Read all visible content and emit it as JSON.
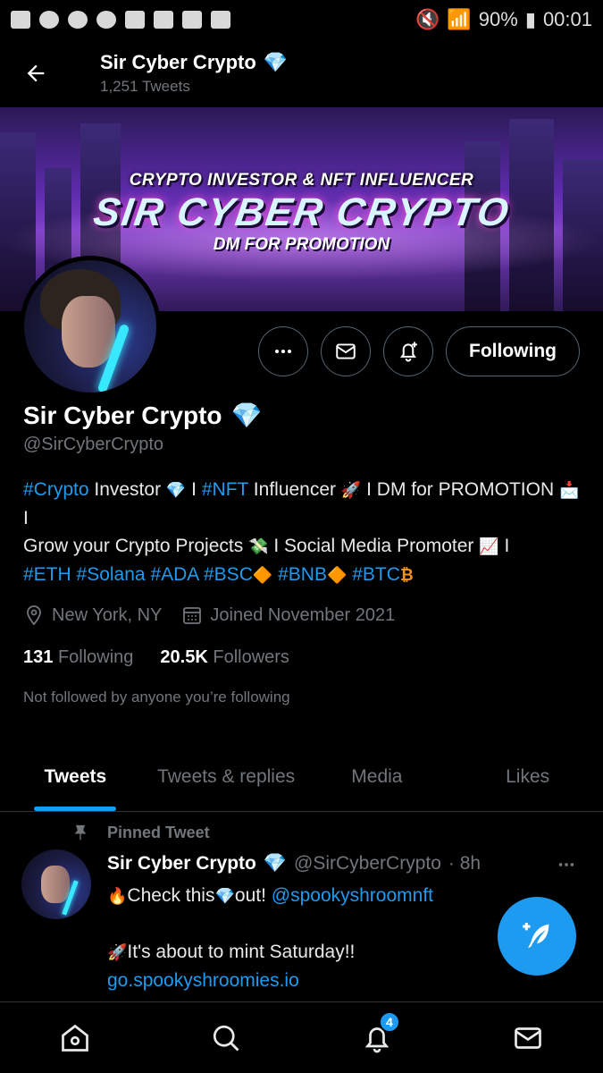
{
  "status_bar": {
    "battery": "90%",
    "time": "00:01"
  },
  "header": {
    "title": "Sir Cyber Crypto",
    "tweet_count": "1,251 Tweets",
    "back_icon": "arrow-left-icon"
  },
  "banner": {
    "top_line": "CRYPTO INVESTOR & NFT INFLUENCER",
    "main_line": "SIR CYBER CRYPTO",
    "bottom_line": "DM FOR PROMOTION"
  },
  "actions": {
    "more_icon": "more-icon",
    "message_icon": "envelope-icon",
    "notify_icon": "bell-plus-icon",
    "follow_label": "Following"
  },
  "profile": {
    "name": "Sir Cyber Crypto",
    "handle": "@SirCyberCrypto",
    "bio": {
      "t1": "#Crypto",
      "t2": " Investor ",
      "t3": " I ",
      "t4": "#NFT",
      "t5": " Influencer ",
      "t6": " I DM for PROMOTION ",
      "t7": " I",
      "t8": "Grow your Crypto Projects ",
      "t9": " I Social Media Promoter ",
      "t10": " I",
      "h1": "#ETH",
      "h2": "#Solana",
      "h3": "#ADA",
      "h4": "#BSC",
      "h5": "#BNB",
      "h6": "#BTC"
    },
    "location": "New York, NY",
    "joined": "Joined November 2021",
    "following_count": "131",
    "following_label": "Following",
    "followers_count": "20.5K",
    "followers_label": "Followers",
    "not_followed": "Not followed by anyone you’re following"
  },
  "tabs": [
    "Tweets",
    "Tweets & replies",
    "Media",
    "Likes"
  ],
  "tweet": {
    "pinned_label": "Pinned Tweet",
    "name": "Sir Cyber Crypto",
    "handle": "@SirCyberCrypto",
    "time": "· 8h",
    "line1_a": "Check this",
    "line1_b": "out! ",
    "mention": "@spookyshroomnft",
    "line2": "It's about to mint Saturday!!",
    "link": "go.spookyshroomies.io"
  },
  "bottom_nav": {
    "notifications_badge": "4"
  },
  "colors": {
    "accent": "#1d9bf0",
    "background": "#000000",
    "muted": "#71767b"
  }
}
